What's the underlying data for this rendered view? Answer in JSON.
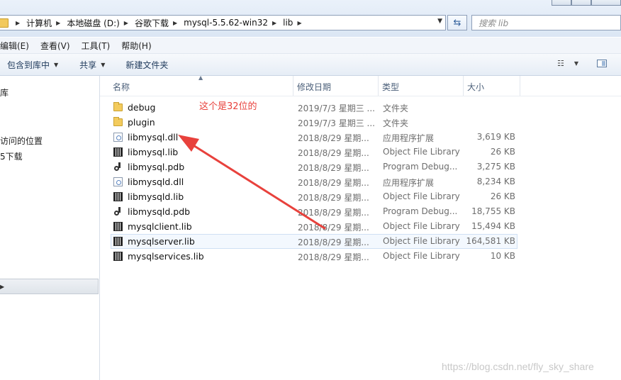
{
  "address_bar": {
    "breadcrumbs": [
      "计算机",
      "本地磁盘 (D:)",
      "谷歌下载",
      "mysql-5.5.62-win32",
      "lib"
    ],
    "search_placeholder": "搜索 lib"
  },
  "menu": {
    "items": [
      "编辑(E)",
      "查看(V)",
      "工具(T)",
      "帮助(H)"
    ]
  },
  "toolbar": {
    "include_in_library": "包含到库中",
    "share": "共享",
    "new_folder": "新建文件夹"
  },
  "navigation": {
    "items": [
      "库",
      "访问的位置",
      "下载"
    ]
  },
  "file_list": {
    "columns": {
      "name": "名称",
      "date": "修改日期",
      "type": "类型",
      "size": "大小"
    },
    "rows": [
      {
        "name": "debug",
        "date": "2019/7/3 星期三 ...",
        "type": "文件夹",
        "size": "",
        "icon": "folder-icon"
      },
      {
        "name": "plugin",
        "date": "2019/7/3 星期三 ...",
        "type": "文件夹",
        "size": "",
        "icon": "folder-icon"
      },
      {
        "name": "libmysql.dll",
        "date": "2018/8/29 星期...",
        "type": "应用程序扩展",
        "size": "3,619 KB",
        "icon": "dll-file-icon"
      },
      {
        "name": "libmysql.lib",
        "date": "2018/8/29 星期...",
        "type": "Object File Library",
        "size": "26 KB",
        "icon": "lib-file-icon"
      },
      {
        "name": "libmysql.pdb",
        "date": "2018/8/29 星期...",
        "type": "Program Debug...",
        "size": "3,275 KB",
        "icon": "pdb-file-icon"
      },
      {
        "name": "libmysqld.dll",
        "date": "2018/8/29 星期...",
        "type": "应用程序扩展",
        "size": "8,234 KB",
        "icon": "dll-file-icon"
      },
      {
        "name": "libmysqld.lib",
        "date": "2018/8/29 星期...",
        "type": "Object File Library",
        "size": "26 KB",
        "icon": "lib-file-icon"
      },
      {
        "name": "libmysqld.pdb",
        "date": "2018/8/29 星期...",
        "type": "Program Debug...",
        "size": "18,755 KB",
        "icon": "pdb-file-icon"
      },
      {
        "name": "mysqlclient.lib",
        "date": "2018/8/29 星期...",
        "type": "Object File Library",
        "size": "15,494 KB",
        "icon": "lib-file-icon"
      },
      {
        "name": "mysqlserver.lib",
        "date": "2018/8/29 星期...",
        "type": "Object File Library",
        "size": "164,581 KB",
        "icon": "lib-file-icon"
      },
      {
        "name": "mysqlservices.lib",
        "date": "2018/8/29 星期...",
        "type": "Object File Library",
        "size": "10 KB",
        "icon": "lib-file-icon"
      }
    ]
  },
  "annotation": {
    "text": "这个是32位的",
    "color": "#e8413c"
  },
  "watermark": "https://blog.csdn.net/fly_sky_share"
}
